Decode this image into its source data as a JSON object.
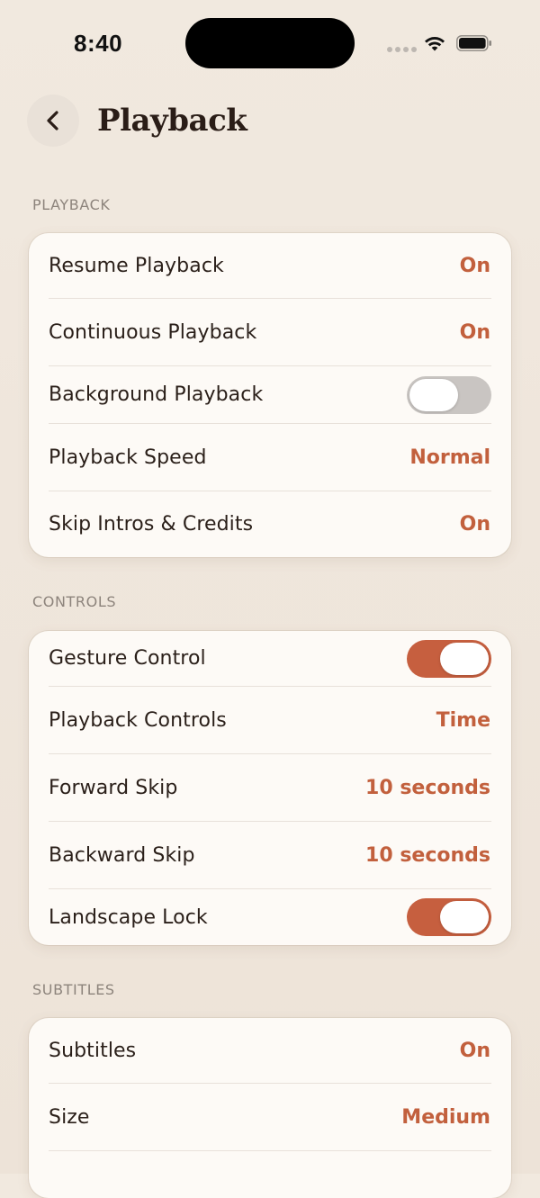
{
  "status": {
    "time": "8:40"
  },
  "header": {
    "title": "Playback",
    "back_icon": "chevron-left-icon"
  },
  "colors": {
    "accent": "#c65f3f",
    "value_text": "#c2603d",
    "toggle_off": "#c9c5c2",
    "card_bg": "#fdfaf6",
    "page_bg": "#efe6dc"
  },
  "sections": {
    "playback": {
      "label": "PLAYBACK",
      "rows": [
        {
          "label": "Resume Playback",
          "value": "On"
        },
        {
          "label": "Continuous Playback",
          "value": "On"
        },
        {
          "label": "Background Playback",
          "toggle": false
        },
        {
          "label": "Playback Speed",
          "value": "Normal"
        },
        {
          "label": "Skip Intros & Credits",
          "value": "On"
        }
      ]
    },
    "controls": {
      "label": "CONTROLS",
      "rows": [
        {
          "label": "Gesture Control",
          "toggle": true
        },
        {
          "label": "Playback Controls",
          "value": "Time"
        },
        {
          "label": "Forward Skip",
          "value": "10 seconds"
        },
        {
          "label": "Backward Skip",
          "value": "10 seconds"
        },
        {
          "label": "Landscape Lock",
          "toggle": true
        }
      ]
    },
    "subtitles": {
      "label": "SUBTITLES",
      "rows": [
        {
          "label": "Subtitles",
          "value": "On"
        },
        {
          "label": "Size",
          "value": "Medium"
        }
      ]
    }
  }
}
